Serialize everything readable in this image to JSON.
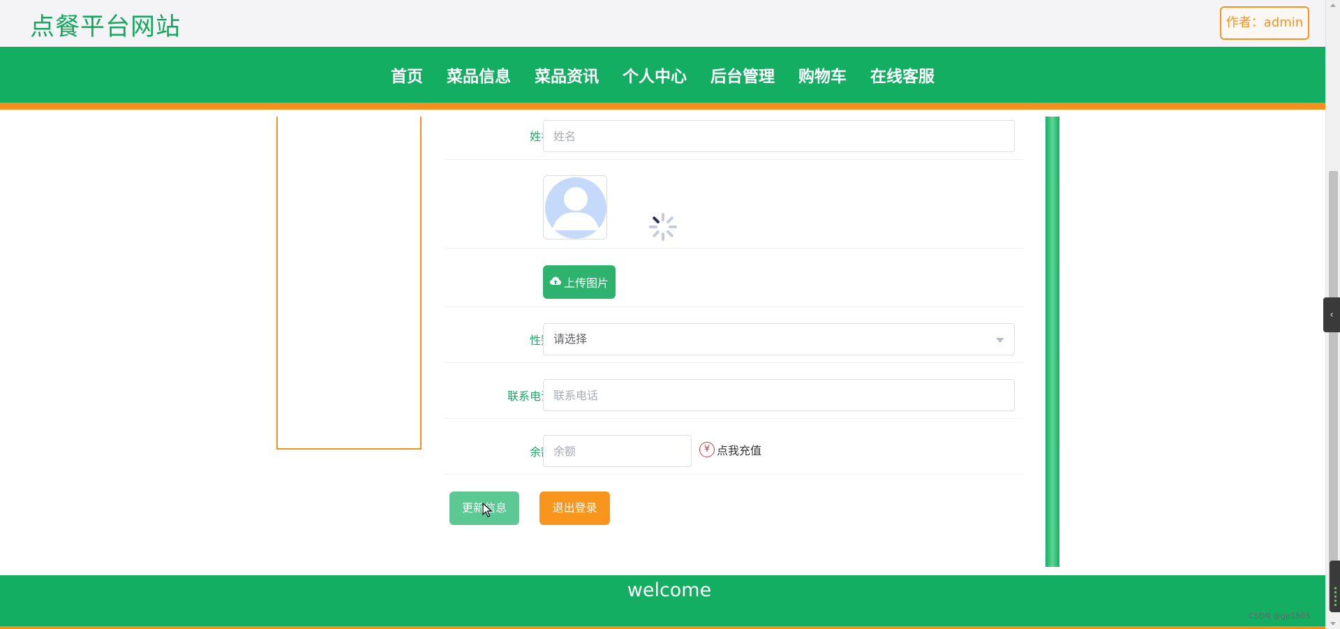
{
  "header": {
    "site_title": "点餐平台网站",
    "author_label": "作者：admin"
  },
  "nav": {
    "items": [
      "首页",
      "菜品信息",
      "菜品资讯",
      "个人中心",
      "后台管理",
      "购物车",
      "在线客服"
    ]
  },
  "form": {
    "name": {
      "label": "姓名",
      "placeholder": "姓名",
      "value": ""
    },
    "avatar": {
      "upload_label": "上传图片"
    },
    "gender": {
      "label": "性别",
      "placeholder": "请选择"
    },
    "phone": {
      "label": "联系电话",
      "placeholder": "联系电话",
      "value": ""
    },
    "balance": {
      "label": "余额",
      "placeholder": "余额",
      "value": "",
      "recharge_label": "点我充值",
      "recharge_icon_glyph": "¥"
    },
    "update_label": "更新信息",
    "logout_label": "退出登录"
  },
  "footer": {
    "text": "welcome",
    "watermark": "CSDN @gp1803"
  },
  "colors": {
    "brand_green": "#14ae63",
    "accent_orange": "#f5901e",
    "label_green": "#14ae63"
  },
  "icons": {
    "upload": "cloud-upload-icon",
    "recharge": "yen-icon",
    "avatar": "user-avatar-icon",
    "loading": "loading-spinner-icon"
  }
}
